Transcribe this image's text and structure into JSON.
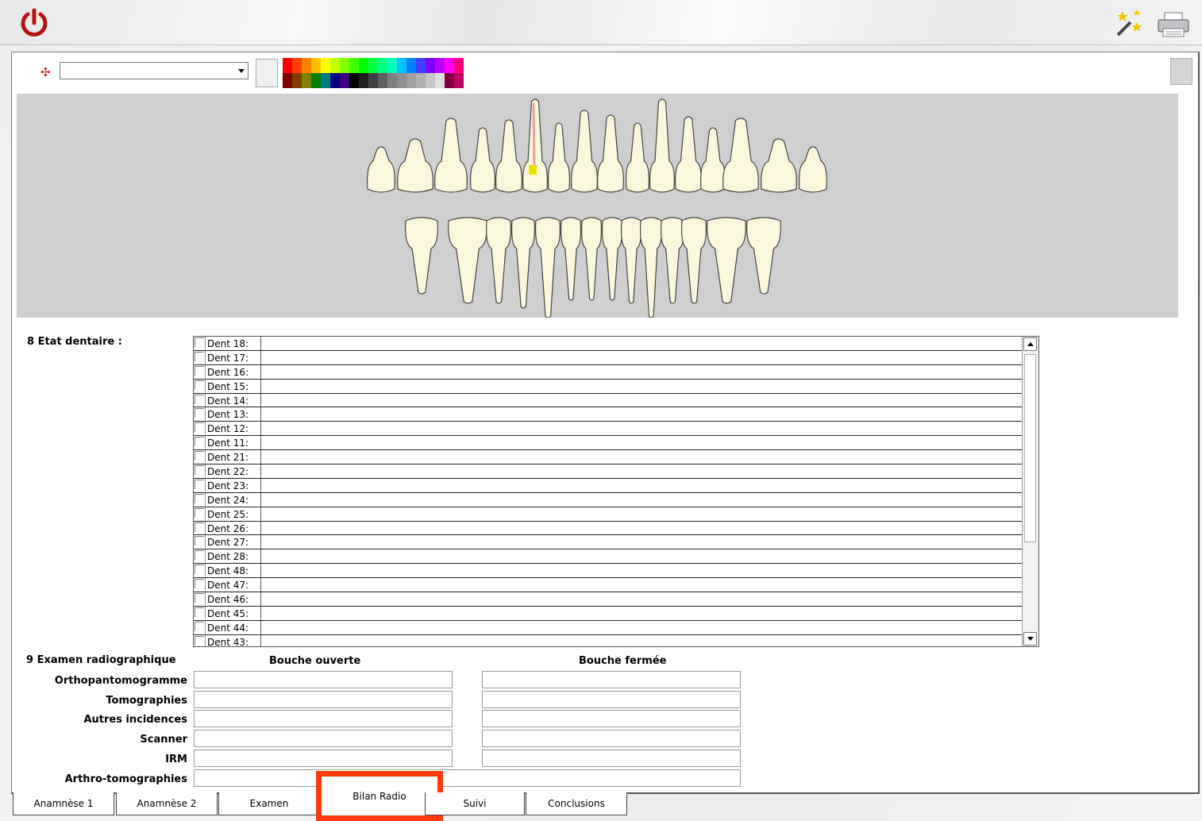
{
  "toolbar": {
    "combo_value": ""
  },
  "palette": {
    "colors_top": [
      "#ff0000",
      "#ff4000",
      "#ff8000",
      "#ffc000",
      "#ffff00",
      "#c0ff00",
      "#80ff00",
      "#40ff00",
      "#00ff00",
      "#00ff40",
      "#00ff80",
      "#00ffc0",
      "#00c0ff",
      "#0080ff",
      "#4040ff",
      "#8000ff",
      "#c000ff",
      "#ff00ff",
      "#ff0080"
    ],
    "colors_bottom": [
      "#800000",
      "#804000",
      "#808000",
      "#008000",
      "#008080",
      "#000080",
      "#400080",
      "#000000",
      "#202020",
      "#404040",
      "#606060",
      "#808080",
      "#909090",
      "#a0a0a0",
      "#b0b0b0",
      "#c8c8c8",
      "#e0e0e0",
      "#800040",
      "#c00060"
    ]
  },
  "etat": {
    "label": "8 Etat dentaire :",
    "teeth": [
      "Dent 18:",
      "Dent 17:",
      "Dent 16:",
      "Dent 15:",
      "Dent 14:",
      "Dent 13:",
      "Dent 12:",
      "Dent 11:",
      "Dent 21:",
      "Dent 22:",
      "Dent 23:",
      "Dent 24:",
      "Dent 25:",
      "Dent 26:",
      "Dent 27:",
      "Dent 28:",
      "Dent 48:",
      "Dent 47:",
      "Dent 46:",
      "Dent 45:",
      "Dent 44:",
      "Dent 43:"
    ]
  },
  "radio": {
    "title": "9 Examen radiographique",
    "col_open": "Bouche ouverte",
    "col_closed": "Bouche fermée",
    "rows": [
      "Orthopantomogramme",
      "Tomographies",
      "Autres incidences",
      "Scanner",
      "IRM",
      "Arthro-tomographies"
    ]
  },
  "tabs": [
    "Anamnèse 1",
    "Anamnèse 2",
    "Examen",
    "Bilan Radio",
    "Suivi",
    "Conclusions"
  ],
  "tabs_active": "Bilan Radio",
  "colors": {
    "tooth_fill": "#fbf7dc",
    "chart_bg": "#cfcfcf",
    "highlight": "#ff3b0a",
    "marker": "#e8e000"
  }
}
